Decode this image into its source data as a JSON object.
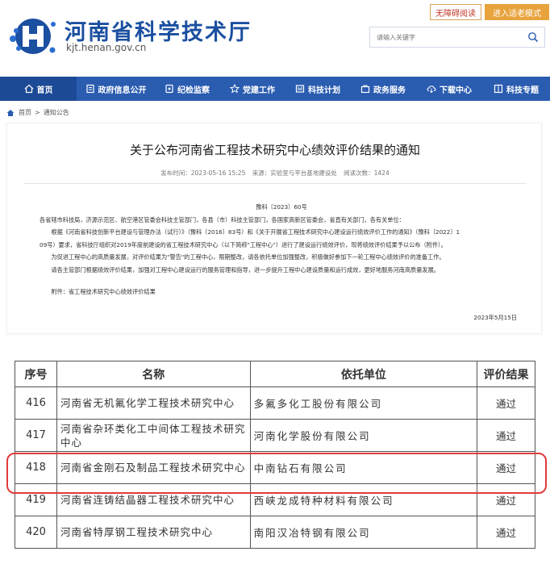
{
  "header": {
    "site_title": "河南省科学技术厅",
    "site_url": "kjt.henan.gov.cn",
    "accessibility_label": "无障碍阅读",
    "elder_mode_label": "进入适老模式",
    "search_placeholder": "请输入关键字"
  },
  "nav": {
    "items": [
      {
        "label": "首页",
        "icon": "home-icon"
      },
      {
        "label": "政府信息公开",
        "icon": "document-icon"
      },
      {
        "label": "纪检监察",
        "icon": "report-icon"
      },
      {
        "label": "党建工作",
        "icon": "star-icon"
      },
      {
        "label": "科技计划",
        "icon": "plan-icon"
      },
      {
        "label": "政务服务",
        "icon": "briefcase-icon"
      },
      {
        "label": "下载中心",
        "icon": "cloud-download-icon"
      },
      {
        "label": "科技专题",
        "icon": "topic-icon"
      }
    ]
  },
  "breadcrumb": {
    "home": "首页",
    "separator": ">",
    "current": "通知公告"
  },
  "article": {
    "title": "关于公布河南省工程技术研究中心绩效评价结果的通知",
    "publish_time": "发布时间：2023-05-16 15:25",
    "source": "来源：实验室与平台基地建设处",
    "views": "阅读次数：1424",
    "doc_number": "豫科〔2023〕60号",
    "addressee": "各省辖市科技局，济源示范区、航空港区管委会科技主管部门，各县（市）科技主管部门，各国家高新区管委会，省直有关部门，各有关单位：",
    "para1_line1": "根据《河南省科技创新平台建设与管理办法（试行）》（豫科〔2016〕83号）和《关于开展省工程技术研究中心建设运行绩效评价工作的通知》（豫科〔2022〕1",
    "para1_line2": "09号）要求，省科技厅组织对2019年度前建设的省工程技术研究中心（以下简称\"工程中心\"）进行了建设运行绩效评价，现将绩效评价结果予以公布（附件）。",
    "para2": "为促进工程中心的高质量发展，对评价结果为\"警告\"的工程中心，限期整改，请各依托单位加强整改，积极做好参加下一轮工程中心绩效评价的准备工作。",
    "para3": "请各主管部门根据绩效评价结果，加强对工程中心建设运行的服务管理和指导，进一步提升工程中心建设质量和运行成效，更好地服务河南高质量发展。",
    "attachment": "附件：省工程技术研究中心绩效评价结果",
    "date": "2023年5月15日"
  },
  "table": {
    "headers": [
      "序号",
      "名称",
      "依托单位",
      "评价结果"
    ],
    "rows": [
      {
        "num": "416",
        "name": "河南省无机氟化学工程技术研究中心",
        "unit": "多氟多化工股份有限公司",
        "result": "通过"
      },
      {
        "num": "417",
        "name": "河南省杂环类化工中间体工程技术研究中心",
        "unit": "河南化学股份有限公司",
        "result": "通过"
      },
      {
        "num": "418",
        "name": "河南省金刚石及制品工程技术研究中心",
        "unit": "中南钻石有限公司",
        "result": "通过"
      },
      {
        "num": "419",
        "name": "河南省连铸结晶器工程技术研究中心",
        "unit": "西峡龙成特种材料有限公司",
        "result": "通过"
      },
      {
        "num": "420",
        "name": "河南省特厚钢工程技术研究中心",
        "unit": "南阳汉冶特钢有限公司",
        "result": "通过"
      }
    ]
  },
  "colors": {
    "brand_blue": "#1b4fa0",
    "nav_blue": "#2a5cb0",
    "elder_orange": "#e8a33d",
    "highlight_red": "#e23a3a"
  }
}
